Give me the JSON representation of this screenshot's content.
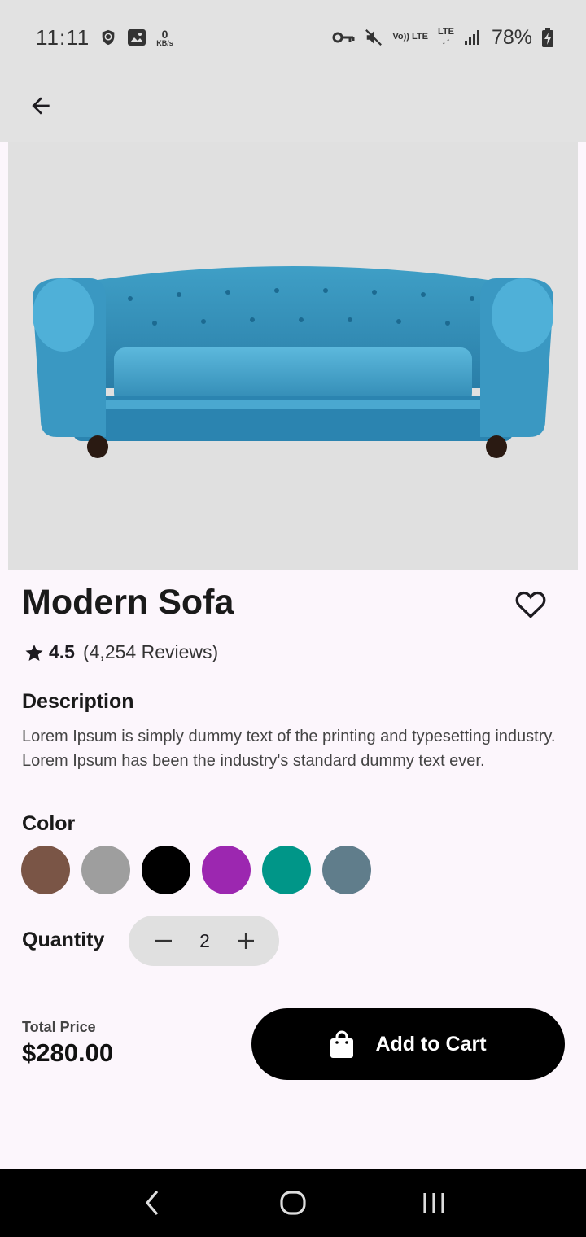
{
  "status_bar": {
    "time": "11:11",
    "data_speed": "0",
    "data_unit": "KB/s",
    "volte": "Vo)) LTE",
    "lte": "LTE",
    "battery": "78%"
  },
  "product": {
    "title": "Modern Sofa",
    "rating": "4.5",
    "reviews": "(4,254 Reviews)",
    "image_icon": "sofa-image"
  },
  "description": {
    "label": "Description",
    "text": "Lorem Ipsum is simply dummy text of the printing and typesetting industry. Lorem Ipsum has been the industry's standard dummy text ever."
  },
  "color": {
    "label": "Color",
    "options": [
      "#7a5546",
      "#9e9e9e",
      "#000000",
      "#9c27b0",
      "#009688",
      "#607d8b"
    ]
  },
  "quantity": {
    "label": "Quantity",
    "value": "2"
  },
  "total": {
    "label": "Total Price",
    "price": "$280.00"
  },
  "cart_button": {
    "label": "Add to Cart"
  }
}
